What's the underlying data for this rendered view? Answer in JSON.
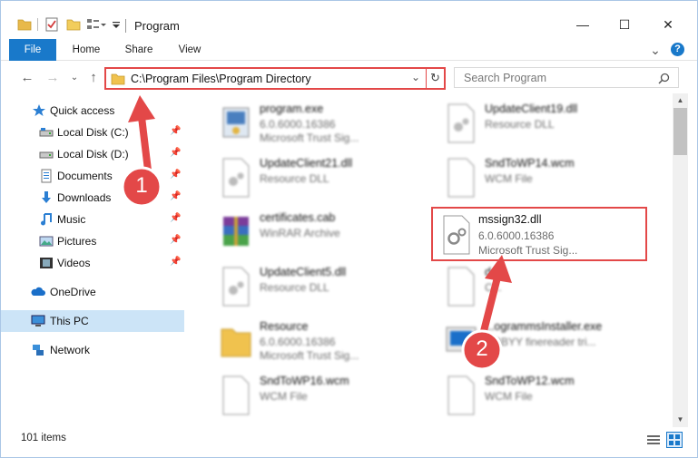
{
  "window": {
    "title": "Program",
    "controls": {
      "minimize": "—",
      "maximize": "☐",
      "close": "✕"
    }
  },
  "ribbon": {
    "tabs": [
      "File",
      "Home",
      "Share",
      "View"
    ],
    "expand_icon": "⌄",
    "help_icon": "?"
  },
  "address": {
    "path": "C:\\Program Files\\Program Directory",
    "search_placeholder": "Search Program"
  },
  "nav": {
    "items": [
      {
        "label": "Quick access",
        "icon": "star-icon"
      },
      {
        "label": "Local Disk (C:)",
        "icon": "drive-icon",
        "pinned": true
      },
      {
        "label": "Local Disk (D:)",
        "icon": "drive-icon",
        "pinned": true
      },
      {
        "label": "Documents",
        "icon": "documents-icon",
        "pinned": true
      },
      {
        "label": "Downloads",
        "icon": "downloads-icon",
        "pinned": true
      },
      {
        "label": "Music",
        "icon": "music-icon",
        "pinned": true
      },
      {
        "label": "Pictures",
        "icon": "pictures-icon",
        "pinned": true
      },
      {
        "label": "Videos",
        "icon": "videos-icon",
        "pinned": true
      },
      {
        "label": "OneDrive",
        "icon": "cloud-icon"
      },
      {
        "label": "This PC",
        "icon": "computer-icon",
        "selected": true
      },
      {
        "label": "Network",
        "icon": "network-icon"
      }
    ]
  },
  "files": [
    {
      "name": "program.exe",
      "line2": "6.0.6000.16386",
      "line3": "Microsoft Trust Sig...",
      "icon": "exe-icon"
    },
    {
      "name": "UpdateClient19.dll",
      "line2": "Resource DLL",
      "line3": "",
      "icon": "dll-icon"
    },
    {
      "name": "UpdateClient21.dll",
      "line2": "Resource DLL",
      "line3": "",
      "icon": "dll-icon"
    },
    {
      "name": "SndToWP14.wcm",
      "line2": "WCM File",
      "line3": "",
      "icon": "file-icon"
    },
    {
      "name": "certificates.cab",
      "line2": "WinRAR Archive",
      "line3": "",
      "icon": "archive-icon"
    },
    {
      "name": "mssign32.dll",
      "line2": "6.0.6000.16386",
      "line3": "Microsoft Trust Sig...",
      "icon": "dll-icon",
      "highlighted": true
    },
    {
      "name": "UpdateClient5.dll",
      "line2": "Resource DLL",
      "line3": "",
      "icon": "dll-icon"
    },
    {
      "name": "d...k",
      "line2": "C...",
      "line3": "",
      "icon": "file-icon"
    },
    {
      "name": "Resource",
      "line2": "6.0.6000.16386",
      "line3": "Microsoft Trust Sig...",
      "icon": "folder-icon"
    },
    {
      "name": "...ogrammsInstaller.exe",
      "line2": "...BBYY finereader tri...",
      "line3": "",
      "icon": "installer-icon"
    },
    {
      "name": "SndToWP16.wcm",
      "line2": "WCM File",
      "line3": "",
      "icon": "file-icon"
    },
    {
      "name": "SndToWP12.wcm",
      "line2": "WCM File",
      "line3": "",
      "icon": "file-icon"
    }
  ],
  "status": {
    "items_count": "101 items"
  },
  "annotations": [
    {
      "label": "1"
    },
    {
      "label": "2"
    }
  ],
  "colors": {
    "accent": "#1979ca",
    "highlight_red": "#e34848",
    "selection": "#cce4f7"
  }
}
